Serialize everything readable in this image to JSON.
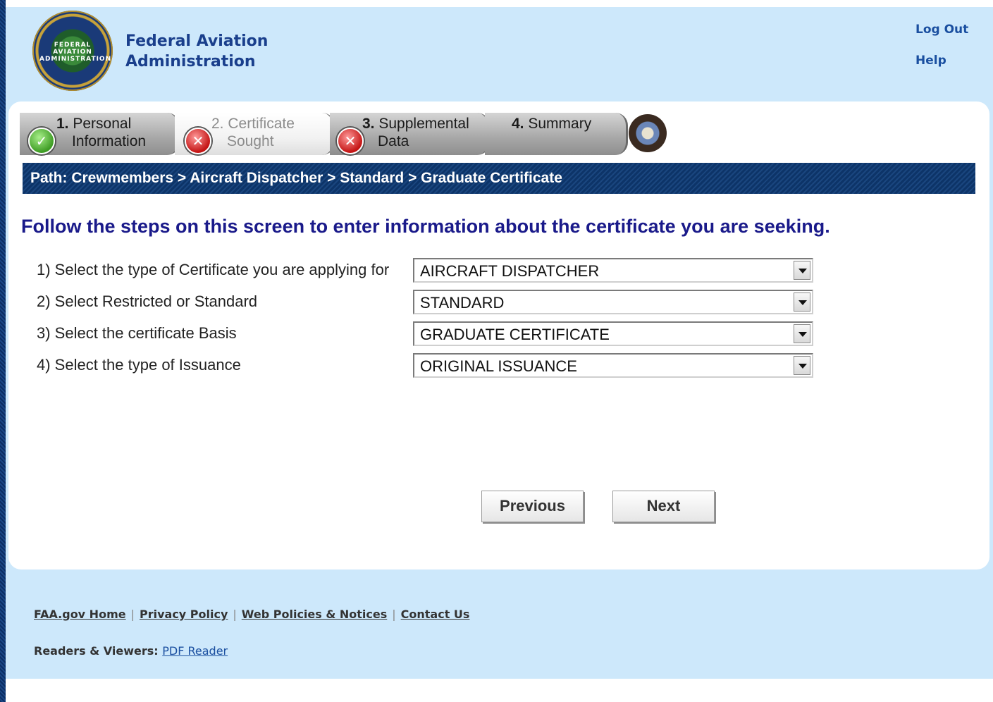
{
  "header": {
    "agency_line1": "Federal Aviation",
    "agency_line2": "Administration",
    "logout": "Log Out",
    "help": "Help",
    "logo_text": "FEDERAL AVIATION ADMINISTRATION"
  },
  "steps": [
    {
      "number": "1.",
      "line1": "Personal",
      "line2": "Information",
      "status": "complete"
    },
    {
      "number": "2.",
      "line1": "Certificate",
      "line2": "Sought",
      "status": "incomplete",
      "active": true
    },
    {
      "number": "3.",
      "line1": "Supplemental",
      "line2": "Data",
      "status": "incomplete"
    },
    {
      "number": "4.",
      "line1": "Summary",
      "line2": "",
      "status": "none"
    }
  ],
  "path": "Path: Crewmembers > Aircraft Dispatcher > Standard > Graduate Certificate",
  "heading": "Follow the steps on this screen to enter information about the certificate you are seeking.",
  "form": {
    "fields": [
      {
        "label": "1) Select the type of Certificate you are applying for",
        "value": "AIRCRAFT DISPATCHER"
      },
      {
        "label": "2) Select Restricted or Standard",
        "value": "STANDARD"
      },
      {
        "label": "3) Select the certificate Basis",
        "value": "GRADUATE CERTIFICATE"
      },
      {
        "label": "4) Select the type of Issuance",
        "value": "ORIGINAL ISSUANCE"
      }
    ]
  },
  "buttons": {
    "previous": "Previous",
    "next": "Next"
  },
  "footer": {
    "links": [
      "FAA.gov Home",
      "Privacy Policy",
      "Web Policies & Notices",
      "Contact Us"
    ],
    "separator": "|",
    "readers_label": "Readers & Viewers:",
    "pdf_reader": "PDF Reader"
  },
  "colors": {
    "page_bg": "#cde8fb",
    "path_bar": "#0d3468",
    "heading": "#1a1a8a",
    "link": "#1a4fa0"
  }
}
